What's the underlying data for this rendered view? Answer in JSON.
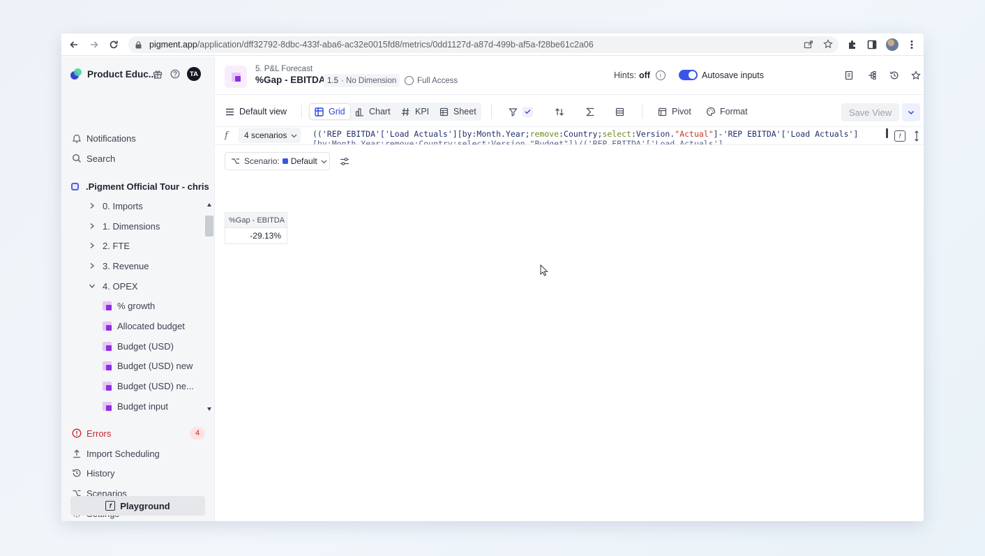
{
  "browser": {
    "url_host": "pigment.app",
    "url_path": "/application/dff32792-8dbc-433f-aba6-ac32e0015fd8/metrics/0dd1127d-a87d-499b-af5a-f28be61c2a06"
  },
  "sidebar": {
    "workspace_name": "Product Educ...",
    "avatar_initials": "TA",
    "notifications_label": "Notifications",
    "search_label": "Search",
    "app_title": ".Pigment Official Tour - chris",
    "tree": [
      {
        "label": "0. Imports",
        "type": "folder",
        "expanded": false
      },
      {
        "label": "1. Dimensions",
        "type": "folder",
        "expanded": false
      },
      {
        "label": "2. FTE",
        "type": "folder",
        "expanded": false
      },
      {
        "label": "3. Revenue",
        "type": "folder",
        "expanded": false
      },
      {
        "label": "4. OPEX",
        "type": "folder",
        "expanded": true
      },
      {
        "label": "% growth",
        "type": "metric"
      },
      {
        "label": "Allocated budget",
        "type": "metric"
      },
      {
        "label": "Budget (USD)",
        "type": "metric"
      },
      {
        "label": "Budget (USD) new",
        "type": "metric"
      },
      {
        "label": "Budget (USD) ne...",
        "type": "metric"
      },
      {
        "label": "Budget input",
        "type": "metric"
      }
    ],
    "errors_label": "Errors",
    "errors_count": "4",
    "import_scheduling_label": "Import Scheduling",
    "history_label": "History",
    "scenarios_label": "Scenarios",
    "settings_label": "Settings",
    "playground_label": "Playground"
  },
  "header": {
    "breadcrumb": "5. P&L Forecast",
    "title": "%Gap - EBITDA",
    "dimension_count": "1.5",
    "dimension_label": "· No Dimension",
    "access_label": "Full Access",
    "hints_label": "Hints:",
    "hints_value": "off",
    "autosave_label": "Autosave inputs"
  },
  "toolbar": {
    "default_view_label": "Default view",
    "grid_label": "Grid",
    "chart_label": "Chart",
    "kpi_label": "KPI",
    "sheet_label": "Sheet",
    "pivot_label": "Pivot",
    "format_label": "Format",
    "save_view_label": "Save View"
  },
  "formula": {
    "scenarios_label": "4 scenarios",
    "line1_parts": [
      {
        "t": "(('REP EBITDA'['Load Actuals'][by:Month.Year;",
        "c": "s"
      },
      {
        "t": "remove",
        "c": "kw"
      },
      {
        "t": ":Country;",
        "c": "s"
      },
      {
        "t": "select",
        "c": "kw"
      },
      {
        "t": ":Version.",
        "c": "s"
      },
      {
        "t": "\"Actual\"",
        "c": "str"
      },
      {
        "t": "]-'REP EBITDA'['Load Actuals']",
        "c": "s"
      }
    ],
    "line2": "[by:Month.Year;remove:Country;select:Version.\"Budget\"])/('REP EBITDA'['Load Actuals']"
  },
  "filter": {
    "scenario_label": "Scenario:",
    "scenario_value": "Default"
  },
  "grid": {
    "column_header": "%Gap - EBITDA",
    "value": "-29.13%"
  }
}
